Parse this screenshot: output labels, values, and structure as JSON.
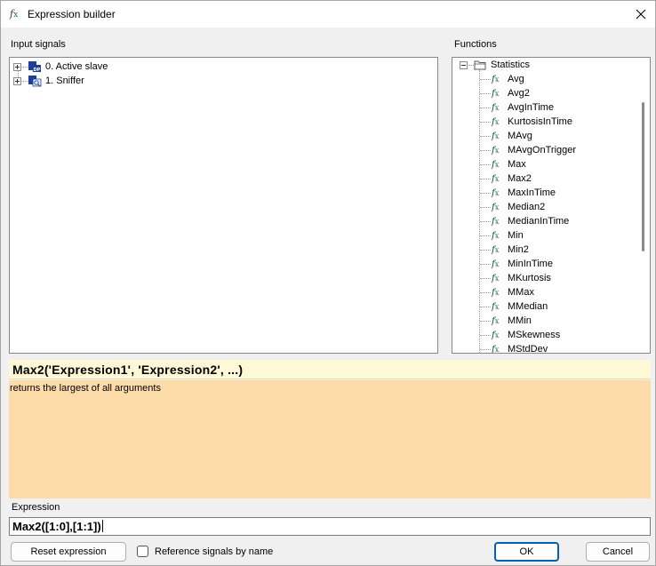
{
  "window": {
    "title": "Expression builder"
  },
  "input_signals": {
    "label": "Input signals",
    "items": [
      {
        "label": "0. Active slave",
        "icon": "dp-slave-icon"
      },
      {
        "label": "1. Sniffer",
        "icon": "sniffer-icon"
      }
    ]
  },
  "functions": {
    "label": "Functions",
    "folder": {
      "label": "Statistics",
      "icon": "folder-icon"
    },
    "items": [
      "Avg",
      "Avg2",
      "AvgInTime",
      "KurtosisInTime",
      "MAvg",
      "MAvgOnTrigger",
      "Max",
      "Max2",
      "MaxInTime",
      "Median2",
      "MedianInTime",
      "Min",
      "Min2",
      "MinInTime",
      "MKurtosis",
      "MMax",
      "MMedian",
      "MMin",
      "MSkewness",
      "MStdDev"
    ]
  },
  "selected_function": {
    "signature": "Max2('Expression1', 'Expression2', ...)",
    "description": "returns the largest of all arguments"
  },
  "expression": {
    "label": "Expression",
    "value": "Max2([1:0],[1:1])"
  },
  "buttons": {
    "reset": "Reset expression",
    "ok": "OK",
    "cancel": "Cancel"
  },
  "reference_checkbox": {
    "label": "Reference signals by name",
    "checked": false
  },
  "colors": {
    "accent": "#005fb8",
    "signature_bg": "#fff8d6",
    "description_bg": "#fddcaa"
  }
}
